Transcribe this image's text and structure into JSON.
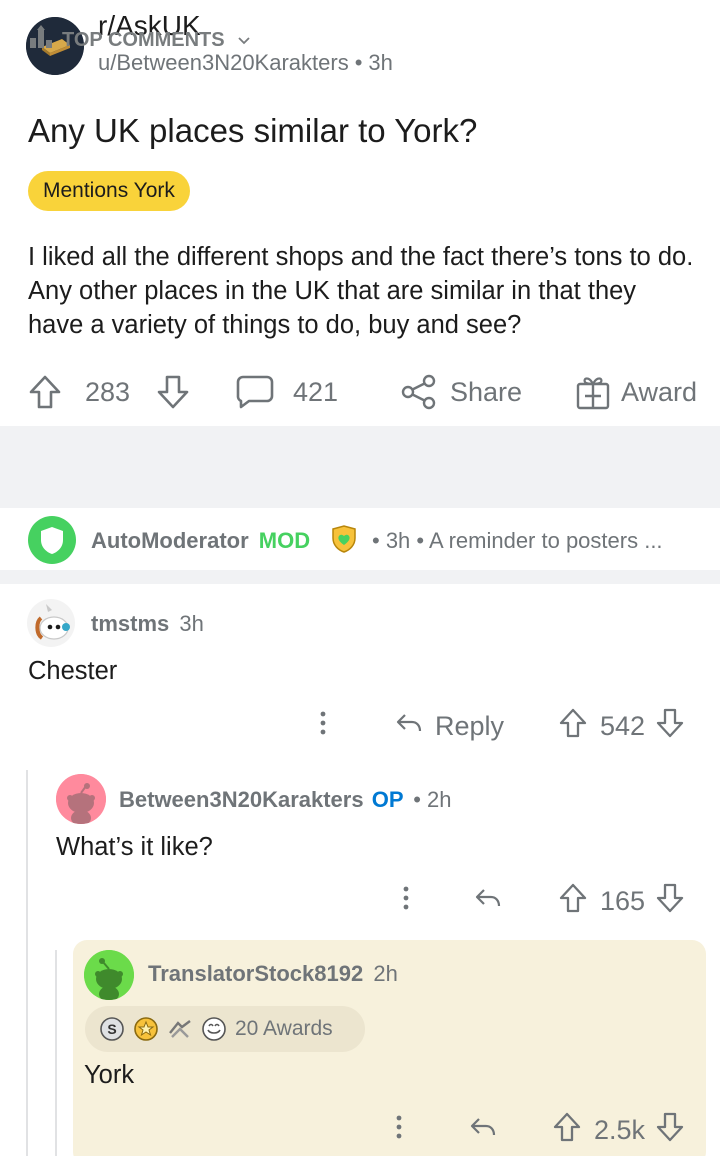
{
  "post": {
    "subreddit": "r/AskUK",
    "author": "u/Between3N20Karakters",
    "age": "3h",
    "title": "Any UK places similar to York?",
    "flair": "Mentions York",
    "flair_color": "#f9d33a",
    "body": "I liked all the different shops and the fact there’s tons to do. Any other places in the UK that are similar in that they have a variety of things to do, buy and see?",
    "votes": "283",
    "comments": "421",
    "share_label": "Share",
    "award_label": "Award"
  },
  "sort": {
    "label": "TOP COMMENTS"
  },
  "automod": {
    "username": "AutoModerator",
    "mod_badge": "MOD",
    "mod_color": "#46d160",
    "meta": "• 3h • A reminder to posters ..."
  },
  "comments": [
    {
      "username": "tmstms",
      "age": "3h",
      "text": "Chester",
      "reply_label": "Reply",
      "votes": "542"
    },
    {
      "username": "Between3N20Karakters",
      "op_badge": "OP",
      "op_color": "#0079d3",
      "age": "• 2h",
      "text": "What’s it like?",
      "votes": "165"
    },
    {
      "username": "TranslatorStock8192",
      "age": "2h",
      "awards": "20 Awards",
      "text": "York",
      "votes": "2.5k",
      "highlight_color": "#f7f1dc"
    }
  ],
  "icons": [
    "subreddit-icon",
    "upvote-icon",
    "downvote-icon",
    "comment-icon",
    "share-icon",
    "award-icon",
    "sort-icon",
    "chevron-down-icon",
    "shield-icon",
    "mod-badge-icon",
    "more-icon",
    "reply-icon"
  ]
}
